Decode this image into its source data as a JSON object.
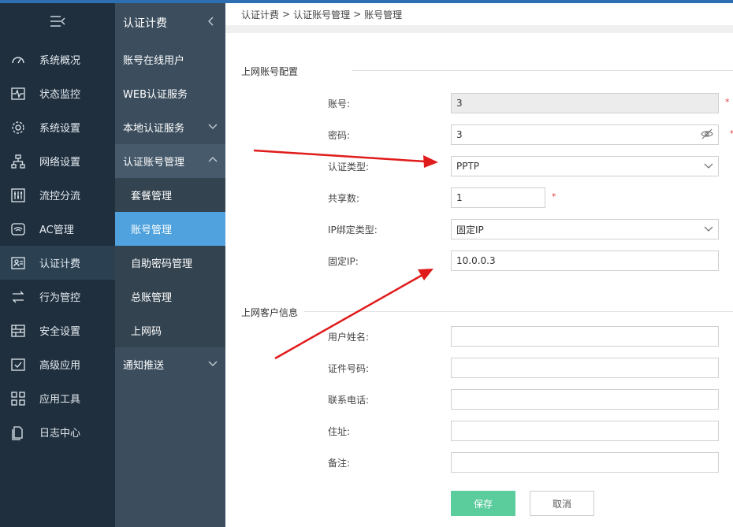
{
  "nav": {
    "items": [
      {
        "label": "系统概况",
        "icon": "dashboard-icon"
      },
      {
        "label": "状态监控",
        "icon": "pulse-monitor-icon"
      },
      {
        "label": "系统设置",
        "icon": "gear-icon"
      },
      {
        "label": "网络设置",
        "icon": "network-icon"
      },
      {
        "label": "流控分流",
        "icon": "sliders-icon"
      },
      {
        "label": "AC管理",
        "icon": "wifi-router-icon"
      },
      {
        "label": "认证计费",
        "icon": "id-card-icon"
      },
      {
        "label": "行为管控",
        "icon": "swap-arrows-icon"
      },
      {
        "label": "安全设置",
        "icon": "firewall-icon"
      },
      {
        "label": "高级应用",
        "icon": "check-box-icon"
      },
      {
        "label": "应用工具",
        "icon": "grid-apps-icon"
      },
      {
        "label": "日志中心",
        "icon": "document-icon"
      }
    ]
  },
  "submenu": {
    "title": "认证计费",
    "items": [
      {
        "label": "账号在线用户"
      },
      {
        "label": "WEB认证服务"
      },
      {
        "label": "本地认证服务"
      },
      {
        "label": "认证账号管理"
      },
      {
        "label": "通知推送"
      }
    ],
    "children": [
      {
        "label": "套餐管理"
      },
      {
        "label": "账号管理"
      },
      {
        "label": "自助密码管理"
      },
      {
        "label": "总账管理"
      },
      {
        "label": "上网码"
      }
    ]
  },
  "breadcrumb": [
    "认证计费",
    ">",
    "认证账号管理",
    ">",
    "账号管理"
  ],
  "section1": {
    "title": "上网账号配置",
    "fields": {
      "account": {
        "label": "账号:",
        "value": "3"
      },
      "password": {
        "label": "密码:",
        "value": "3"
      },
      "auth_type": {
        "label": "认证类型:",
        "value": "PPTP"
      },
      "share_count": {
        "label": "共享数:",
        "value": "1"
      },
      "ip_bind_type": {
        "label": "IP绑定类型:",
        "value": "固定IP"
      },
      "fixed_ip": {
        "label": "固定IP:",
        "value": "10.0.0.3"
      }
    },
    "required_mark": "*"
  },
  "section2": {
    "title": "上网客户信息",
    "fields": {
      "name": {
        "label": "用户姓名:",
        "value": ""
      },
      "id_number": {
        "label": "证件号码:",
        "value": ""
      },
      "phone": {
        "label": "联系电话:",
        "value": ""
      },
      "address": {
        "label": "住址:",
        "value": ""
      },
      "remark": {
        "label": "备注:",
        "value": ""
      }
    }
  },
  "buttons": {
    "save": "保存",
    "cancel": "取消"
  },
  "colors": {
    "nav_bg": "#1f2f3e",
    "submenu_bg": "#3c4e5e",
    "active_child": "#4fa2dd",
    "save_button": "#5bcc9c",
    "annotation_arrow": "#e01b1b"
  }
}
